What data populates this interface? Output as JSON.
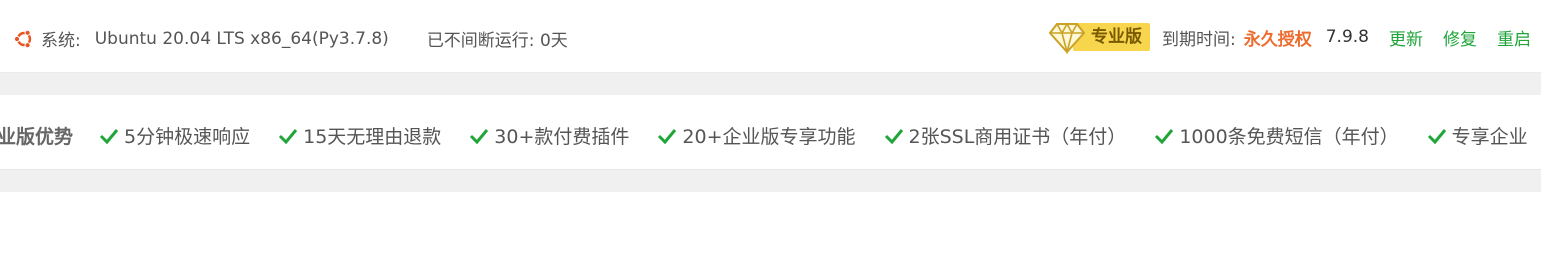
{
  "system": {
    "label": "系统:",
    "os": "Ubuntu 20.04 LTS x86_64(Py3.7.8)",
    "uptime": "已不间断运行: 0天"
  },
  "license": {
    "badge": "专业版",
    "expire_label": "到期时间:",
    "expire_value": "永久授权",
    "version": "7.9.8"
  },
  "actions": {
    "update": "更新",
    "repair": "修复",
    "restart": "重启"
  },
  "advantages": {
    "title": "企业版优势",
    "items": [
      "5分钟极速响应",
      "15天无理由退款",
      "30+款付费插件",
      "20+企业版专享功能",
      "2张SSL商用证书（年付）",
      "1000条免费短信（年付）",
      "专享企业"
    ]
  },
  "colors": {
    "accent_green": "#20a53a",
    "expire_orange": "#ef6c2f",
    "badge_yellow": "#f7d64d"
  },
  "icons": [
    "ubuntu-icon",
    "diamond-icon",
    "check-icon"
  ]
}
